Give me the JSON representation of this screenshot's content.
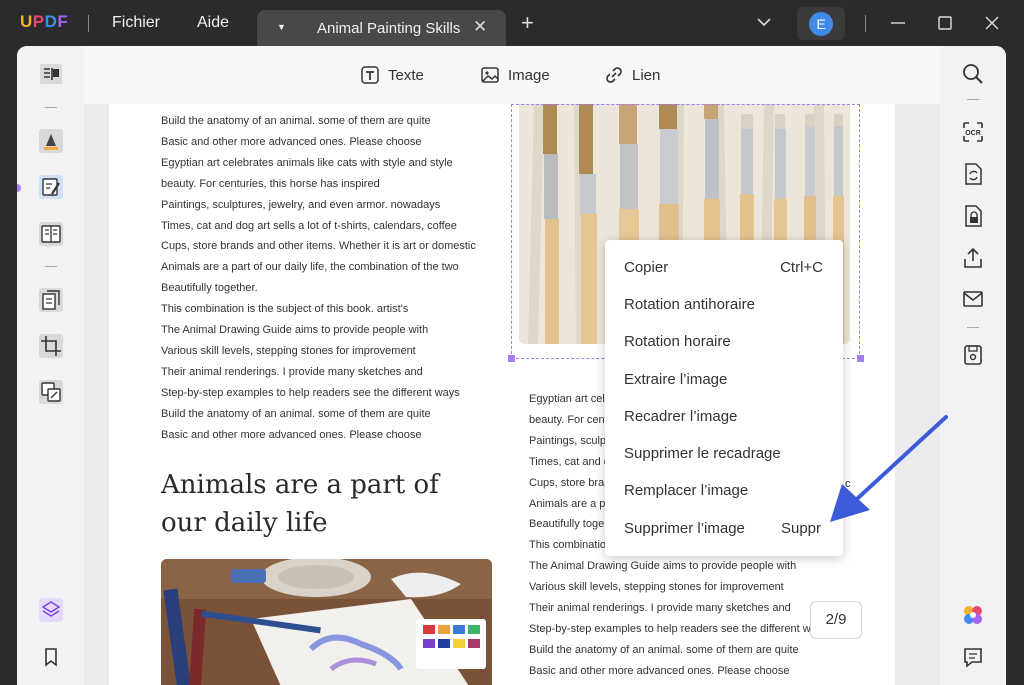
{
  "app": {
    "logo": {
      "u": "U",
      "p": "P",
      "d": "D",
      "f": "F"
    },
    "menu": [
      "Fichier",
      "Aide"
    ],
    "tab_title": "Animal Painting Skills",
    "avatar_letter": "E"
  },
  "toolbar": {
    "text": "Texte",
    "image": "Image",
    "link": "Lien"
  },
  "page": {
    "left_text": [
      "Build the anatomy of an animal. some of them are quite",
      "Basic and other more advanced ones. Please choose",
      "Egyptian art celebrates animals like cats with style and style",
      "beauty. For centuries, this horse has inspired",
      "Paintings, sculptures, jewelry, and even armor. nowadays",
      "Times, cat and dog art sells a lot of t-shirts, calendars, coffee",
      "Cups, store brands and other items. Whether it is art or domestic",
      "Animals are a part of our daily life, the combination of the two",
      "Beautifully together.",
      "This combination is the subject of this book. artist's",
      "The Animal Drawing Guide aims to provide people with",
      "Various skill levels, stepping stones for improvement",
      "Their animal renderings. I provide many sketches and",
      "Step-by-step examples to help readers see the different ways",
      "Build the anatomy of an animal. some of them are quite",
      "Basic and other more advanced ones. Please choose"
    ],
    "heading_line1": "Animals are a part of",
    "heading_line2": "our daily life",
    "right_text": [
      "Egyptian art cel",
      "beauty. For cent",
      "Paintings, sculp",
      "Times, cat and d",
      "Cups, store bran",
      "Animals are a p",
      "Beautifully toge",
      "This combinatio",
      "The Animal Drawing Guide aims to provide people with",
      "Various skill levels, stepping stones for improvement",
      "Their animal renderings. I provide many sketches and",
      "Step-by-step examples to help readers see the different w",
      "Build the anatomy of an animal. some of them are quite",
      "Basic and other more advanced ones. Please choose"
    ],
    "right_text_stray": "c"
  },
  "context_menu": {
    "copy": "Copier",
    "copy_shortcut": "Ctrl+C",
    "rotate_ccw": "Rotation antihoraire",
    "rotate_cw": "Rotation horaire",
    "extract": "Extraire l’image",
    "crop": "Recadrer l’image",
    "remove_crop": "Supprimer le recadrage",
    "replace": "Remplacer l’image",
    "delete": "Supprimer l’image",
    "delete_shortcut": "Suppr"
  },
  "pagination": "2/9",
  "colors": {
    "accent": "#a77ef2",
    "arrow": "#3d5bd9",
    "avatar": "#3f8ae8"
  }
}
